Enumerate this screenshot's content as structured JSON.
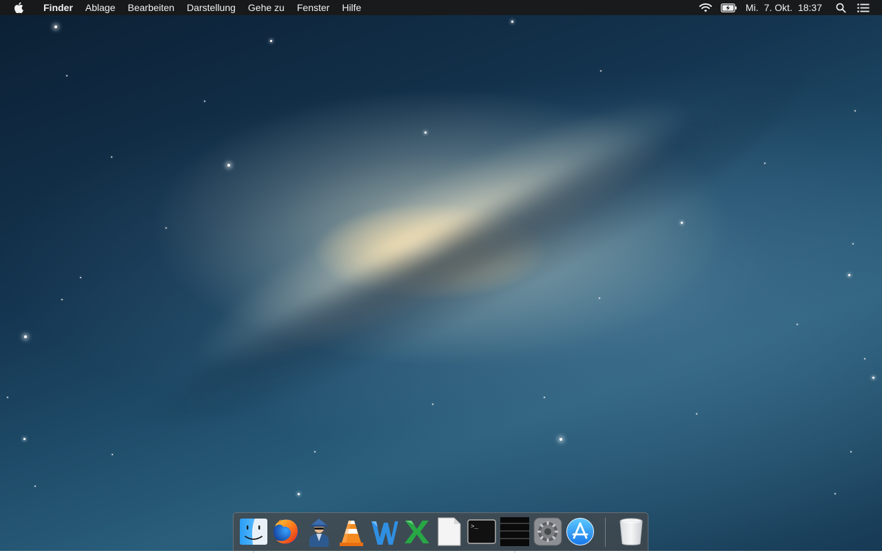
{
  "menubar": {
    "app_name": "Finder",
    "items": [
      "Ablage",
      "Bearbeiten",
      "Darstellung",
      "Gehe zu",
      "Fenster",
      "Hilfe"
    ],
    "icons": {
      "apple": "apple-icon",
      "wifi": "wifi-icon",
      "battery": "battery-charging-icon",
      "spotlight": "spotlight-search-icon",
      "notifications": "notification-center-icon"
    },
    "clock": {
      "day": "Mi.",
      "date": "7. Okt.",
      "time": "18:37"
    }
  },
  "dock": {
    "apps": [
      {
        "name": "Finder",
        "icon": "finder-icon",
        "running": true
      },
      {
        "name": "Firefox",
        "icon": "firefox-icon",
        "running": false
      },
      {
        "name": "Agent",
        "icon": "agent-icon",
        "running": false
      },
      {
        "name": "VLC",
        "icon": "vlc-icon",
        "running": false
      },
      {
        "name": "Word",
        "icon": "word-icon",
        "running": false
      },
      {
        "name": "Excel",
        "icon": "excel-icon",
        "running": false
      },
      {
        "name": "Document",
        "icon": "blank-document-icon",
        "running": false
      },
      {
        "name": "Terminal",
        "icon": "terminal-icon",
        "running": false
      },
      {
        "name": "Window",
        "icon": "black-window-icon",
        "running": true
      },
      {
        "name": "System Preferences",
        "icon": "system-preferences-icon",
        "running": false
      },
      {
        "name": "App Store",
        "icon": "app-store-icon",
        "running": false
      }
    ],
    "trash": {
      "name": "Trash",
      "icon": "trash-icon"
    },
    "terminal_prompt": ">_"
  },
  "colors": {
    "menubar_bg": "#191919",
    "menubar_text": "#f2f2f2",
    "space_dark": "#0b1f33",
    "space_mid": "#1f4d6a",
    "galaxy_core": "#ffecbe"
  }
}
